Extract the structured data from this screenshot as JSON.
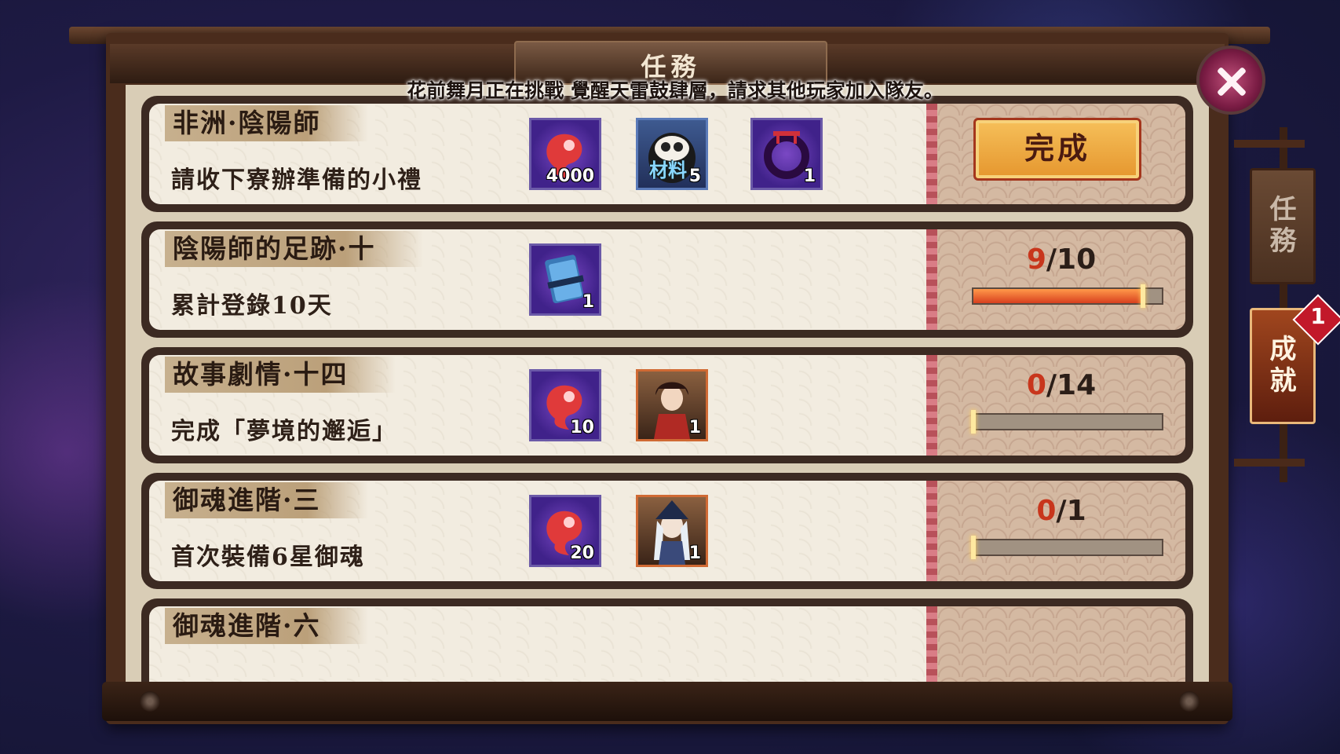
{
  "window": {
    "title": "任務"
  },
  "notice": "花前舞月正在挑戰 覺醒天雷鼓肆層，請求其他玩家加入隊友。",
  "side_tabs": [
    {
      "label": "任務",
      "active": false
    },
    {
      "label": "成就",
      "active": true,
      "badge": "1"
    }
  ],
  "quests": [
    {
      "title": "非洲·陰陽師",
      "description": "請收下寮辦準備的小禮",
      "rewards": [
        {
          "icon": "magatama-icon",
          "count": "4000"
        },
        {
          "icon": "daruma-material-icon",
          "label": "材料",
          "count": "5"
        },
        {
          "icon": "ring-icon",
          "count": "1"
        }
      ],
      "action": "完成"
    },
    {
      "title": "陰陽師的足跡·十",
      "description": "累計登錄10天",
      "rewards": [
        {
          "icon": "ticket-icon",
          "count": "1"
        }
      ],
      "progress": {
        "current": "9",
        "total": "10",
        "fraction": 0.9
      }
    },
    {
      "title": "故事劇情·十四",
      "description": "完成「夢境的邂逅」",
      "rewards": [
        {
          "icon": "magatama-icon",
          "count": "10"
        },
        {
          "icon": "character-card-icon",
          "count": "1"
        }
      ],
      "progress": {
        "current": "0",
        "total": "14",
        "fraction": 0
      }
    },
    {
      "title": "御魂進階·三",
      "description": "首次裝備6星御魂",
      "rewards": [
        {
          "icon": "magatama-icon",
          "count": "20"
        },
        {
          "icon": "character-card-icon",
          "count": "1"
        }
      ],
      "progress": {
        "current": "0",
        "total": "1",
        "fraction": 0
      }
    },
    {
      "title": "御魂進階·六"
    }
  ],
  "colors": {
    "progress_current": "#c8361c",
    "complete_button": "#f0b048",
    "active_tab": "#8a3a1a"
  }
}
